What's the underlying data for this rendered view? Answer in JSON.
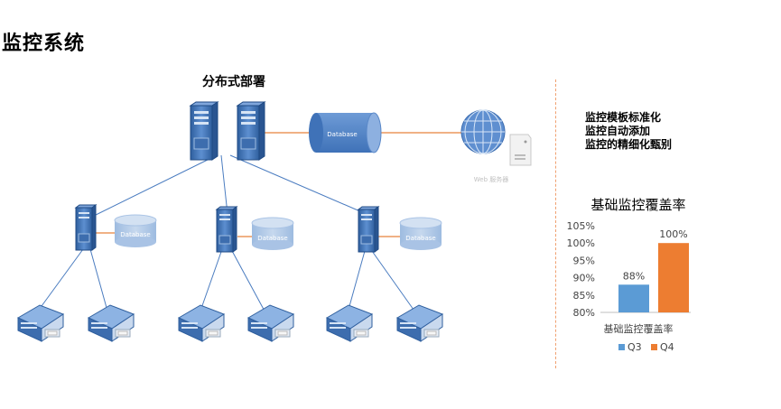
{
  "page": {
    "title": "监控系统"
  },
  "diagram": {
    "title": "分布式部署",
    "database_label": "Database",
    "web_label": "Web 服务器"
  },
  "features": [
    "监控模板标准化",
    "监控自动添加",
    "监控的精细化甄别"
  ],
  "colors": {
    "server_blue": "#4a7cc0",
    "db_blue": "#8fb1db",
    "link_orange": "#e8823c",
    "line_blue": "#4a7cc0",
    "q3": "#5b9bd5",
    "q4": "#ed7d31"
  },
  "chart_data": {
    "type": "bar",
    "title": "基础监控覆盖率",
    "categories": [
      "基础监控覆盖率"
    ],
    "series": [
      {
        "name": "Q3",
        "values": [
          88
        ],
        "label": "88%"
      },
      {
        "name": "Q4",
        "values": [
          100
        ],
        "label": "100%"
      }
    ],
    "ylim": [
      80,
      105
    ],
    "yticks": [
      "80%",
      "85%",
      "90%",
      "95%",
      "100%",
      "105%"
    ],
    "ytick_values": [
      80,
      85,
      90,
      95,
      100,
      105
    ],
    "grid": false,
    "legend": "bottom"
  }
}
